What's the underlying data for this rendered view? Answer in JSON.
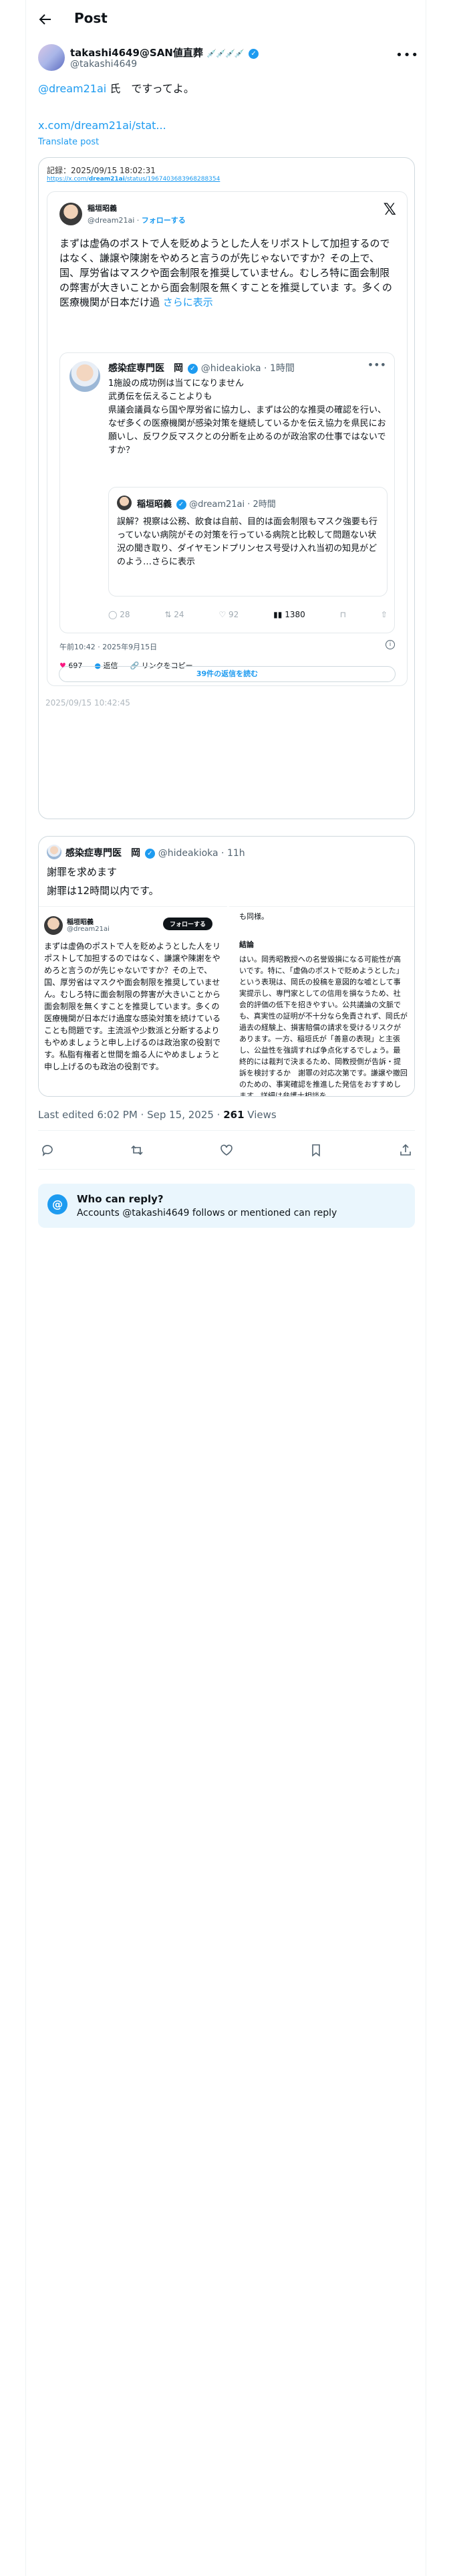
{
  "header": {
    "title": "Post"
  },
  "author": {
    "name": "takashi4649@SAN値直葬",
    "flags": "💉💉💉💉",
    "handle": "@takashi4649"
  },
  "post": {
    "mention": "@dream21ai",
    "text": " 氏　ですってよ。",
    "link": "x.com/dream21ai/stat...",
    "translate": "Translate post"
  },
  "screenshot": {
    "record_label": "記録：2025/09/15 18:02:31",
    "record_url_prefix": "https://x.com/",
    "record_url_bold": "dream21ai",
    "record_url_suffix": "/status/1967403683968288354",
    "embed": {
      "name": "稲垣昭義",
      "handle": "@dream21ai",
      "follow": "フォローする",
      "text": "まずは虚偽のポストで人を貶めようとした人をリポストして加担するのではなく、謙譲や陳謝をやめろと言うのが先じゃないですか？その上で、国、厚労省はマスクや面会制限を推奨していません。むしろ特に面会制限の弊害が大きいことから面会制限を無くすことを推奨していま す。多くの医療機関が日本だけ過",
      "more": "さらに表示",
      "quote1": {
        "name": "感染症専門医　岡",
        "handle": "@hideakioka · 1時間",
        "text": "1施設の成功例は当てになりません\n武勇伝を伝えることよりも\n県議会議員なら国や厚労省に協力し、まずは公的な推奨の確認を行い、なぜ多くの医療機関が感染対策を継続しているかを伝え協力を県民にお願いし、反ワク反マスクとの分断を止めるのが政治家の仕事ではないですか？"
      },
      "quote2": {
        "name": "稲垣昭義",
        "handle": "@dream21ai · 2時間",
        "text": "誤解？視察は公務、飲食は自前、目的は面会制限もマスク強要も行っていない病院がその対策を行っている病院と比較して問題ない状況の聞き取り、ダイヤモンドプリンセス号受け入れ当初の知見がどのよう…さらに表示"
      },
      "q_actions": [
        "◯ 28",
        "⇅ 24",
        "♡ 92",
        "1380",
        "⊓",
        "⇧"
      ],
      "time": "午前10:42 · 2025年9月15日",
      "likes": "697",
      "reply_label": "返信",
      "copy_label": "リンクをコピー",
      "replies_button": "39件の返信を読む"
    },
    "image_time": "2025/09/15 10:42:45"
  },
  "quoted": {
    "name": "感染症専門医　岡",
    "handle": "@hideakioka · 11h",
    "line1": "謝罪を求めます",
    "line2": "謝罪は12時間以内です。",
    "left": {
      "name": "稲垣昭義",
      "handle": "@dream21ai",
      "follow": "フォローする",
      "text": "まずは虚偽のポストで人を貶めようとした人をリポストして加担するのではなく、謙譲や陳謝をやめろと言うのが先じゃないですか？その上で、国、厚労省はマスクや面会制限を推奨していません。むしろ特に面会制限の弊害が大きいことから面会制限を無くすことを推奨しています。多くの医療機関が日本だけ過度な感染対策を続けていることも問題です。主流派や少数派と分断するよりもやめましょうと申し上げるのは政治家の役割です。私脂有権者と世間を煽る人にやめましょうと申し上げるのも政治の役割です。"
    },
    "right": {
      "top": "も同様。",
      "heading": "結論",
      "text": "はい。岡秀昭教授への名誉毀損になる可能性が高いです。特に、「虚偽のポストで貶めようとした」という表現は、岡氏の投稿を意図的な嘘として事実提示し、専門家としての信用を損なうため、社会的評価の低下を招きやすい。公共議論の文脈でも、真実性の証明が不十分なら免責されず、岡氏が過去の経験上、損害賠償の請求を受けるリスクがあります。一方、稲垣氏が「善意の表現」と主張し、公益性を強調すれば争点化するでしょう。最終的には裁判で決まるため、岡教授側が告訴・提訴を検討するか　謝罪の対応次第です。謙譲や撤回のための、事実確認を推進した発信をおすすめします。詳細は弁護士相談を。"
    }
  },
  "meta": {
    "edited": "Last edited 6:02 PM · Sep 15, 2025 · ",
    "views": "261",
    "views_label": " Views"
  },
  "reply_box": {
    "title": "Who can reply?",
    "subtitle": "Accounts @takashi4649 follows or mentioned can reply"
  }
}
